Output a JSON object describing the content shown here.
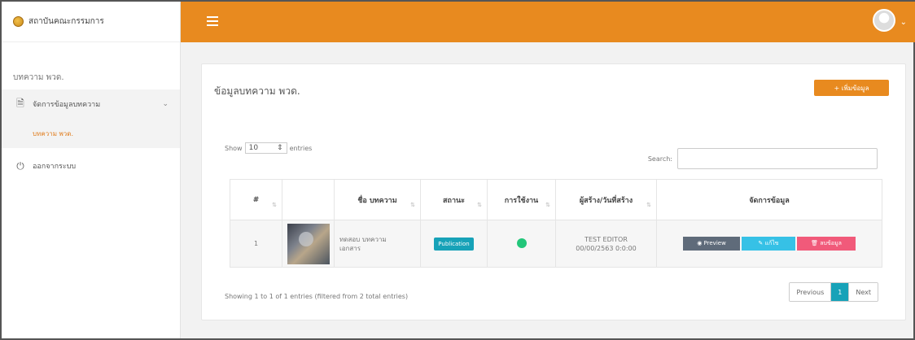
{
  "brand": {
    "name": "สถาบันคณะกรรมการ"
  },
  "sidebar": {
    "section_title": "บทความ พวด.",
    "items": [
      {
        "label": "จัดการข้อมูลบทความ",
        "icon": "document-icon"
      },
      {
        "label": "บทความ พวด.",
        "icon": ""
      },
      {
        "label": "ออกจากระบบ",
        "icon": "power-icon"
      }
    ]
  },
  "topbar": {
    "menu_icon": "hamburger-icon",
    "avatar_icon": "user-avatar-icon"
  },
  "card": {
    "title": "ข้อมูลบทความ พวด.",
    "add_button": "+ เพิ่มข้อมูล"
  },
  "table_controls": {
    "show_label": "Show",
    "length_value": "10",
    "entries_label": "entries",
    "search_label": "Search:"
  },
  "table": {
    "headers": [
      "#",
      "",
      "ชื่อ บทความ",
      "สถานะ",
      "การใช้งาน",
      "ผู้สร้าง/วันที่สร้าง",
      "จัดการข้อมูล"
    ],
    "rows": [
      {
        "index": "1",
        "title": "ทดสอบ บทความ",
        "title_sub": "เอกสาร",
        "status": "Publication",
        "usage": "active",
        "creator": "TEST EDITOR",
        "created": "00/00/2563 0:0:00",
        "actions": [
          "Preview",
          "แก้ไข",
          "ลบข้อมูล"
        ]
      }
    ]
  },
  "footer": {
    "info": "Showing 1 to 1 of 1 entries (filtered from 2 total entries)",
    "pager": [
      "Previous",
      "1",
      "Next"
    ]
  },
  "colors": {
    "accent": "#e88a1f",
    "badge": "#17a2b8",
    "dot": "#22c67a",
    "edit": "#36c1e6",
    "delete": "#f15a7a"
  }
}
